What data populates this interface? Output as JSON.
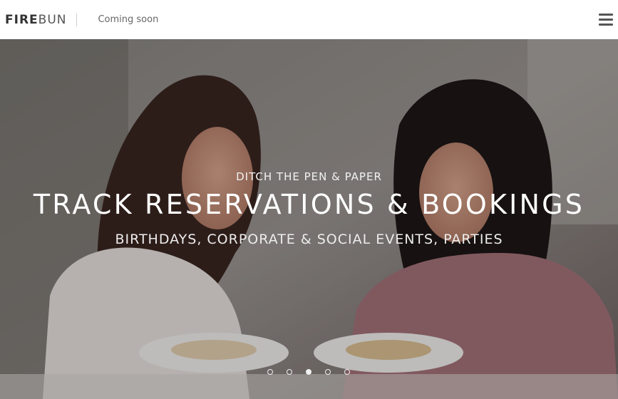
{
  "header": {
    "brand_bold": "FIRE",
    "brand_light": "BUN",
    "tagline": "Coming soon",
    "menu_icon": "hamburger-menu-icon"
  },
  "hero": {
    "kicker": "DITCH THE PEN & PAPER",
    "headline": "TRACK RESERVATIONS & BOOKINGS",
    "subline": "BIRTHDAYS, CORPORATE & SOCIAL EVENTS, PARTIES",
    "image": "two-women-dining-photo"
  },
  "carousel": {
    "slide_count": 5,
    "active_index": 2
  },
  "colors": {
    "header_bg": "#ffffff",
    "text_dark": "#333333",
    "caption_text": "#ffffff"
  }
}
